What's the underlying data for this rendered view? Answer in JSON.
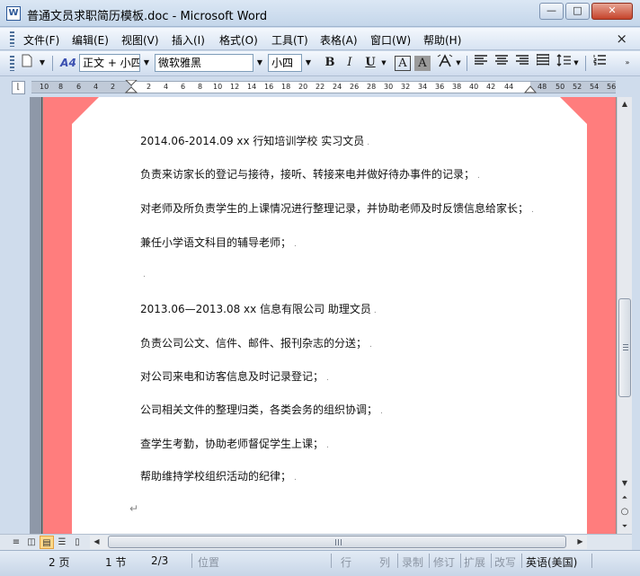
{
  "window": {
    "title": "普通文员求职简历模板.doc - Microsoft Word",
    "app_icon": "W",
    "min_glyph": "—",
    "max_glyph": "□",
    "close_glyph": "✕"
  },
  "menu": {
    "items": [
      "文件(F)",
      "编辑(E)",
      "视图(V)",
      "插入(I)",
      "格式(O)",
      "工具(T)",
      "表格(A)",
      "窗口(W)",
      "帮助(H)"
    ],
    "doc_close_glyph": "×"
  },
  "toolbar": {
    "style_value": "正文 + 小四",
    "font_value": "微软雅黑",
    "size_value": "小四",
    "bold": "B",
    "italic": "I",
    "underline": "U",
    "char_border": "A",
    "char_shading": "A",
    "style_icon": "A4"
  },
  "ruler": {
    "ticks": [
      "10",
      "8",
      "6",
      "4",
      "2",
      "2",
      "4",
      "6",
      "8",
      "10",
      "12",
      "14",
      "16",
      "18",
      "20",
      "22",
      "24",
      "26",
      "28",
      "30",
      "32",
      "34",
      "36",
      "38",
      "40",
      "42",
      "44",
      "48",
      "50",
      "52",
      "54",
      "56"
    ]
  },
  "document": {
    "lines": [
      "2014.06-2014.09            xx 行知培训学校           实习文员",
      "负责来访家长的登记与接待，接听、转接来电并做好待办事件的记录；",
      "对老师及所负责学生的上课情况进行整理记录，并协助老师及时反馈信息给家长；",
      "兼任小学语文科目的辅导老师；",
      "",
      "2013.06—2013.08            xx 信息有限公司           助理文员",
      "负责公司公文、信件、邮件、报刊杂志的分送；",
      "对公司来电和访客信息及时记录登记；",
      "公司相关文件的整理归类，各类会务的组织协调；",
      " 查学生考勤，协助老师督促学生上课；",
      "帮助维持学校组织活动的纪律；"
    ],
    "paragraph_mark": "↵",
    "end_mark": "↵"
  },
  "statusbar": {
    "page": "2 页",
    "section": "1 节",
    "page_of": "2/3",
    "position": "位置",
    "line": "行",
    "column": "列",
    "record": "录制",
    "revise": "修订",
    "extend": "扩展",
    "overwrite": "改写",
    "language": "英语(美国)"
  }
}
